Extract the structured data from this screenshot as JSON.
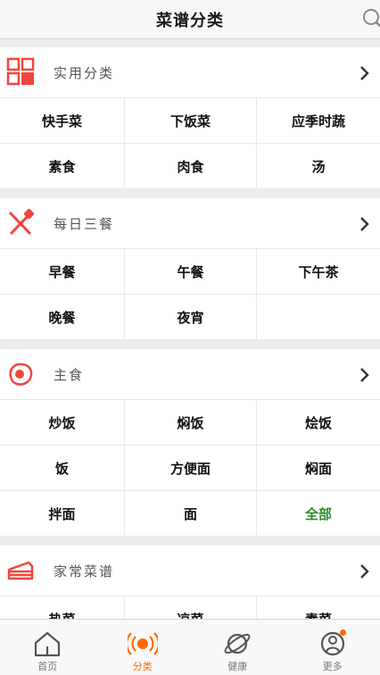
{
  "header": {
    "title": "菜谱分类"
  },
  "sections": [
    {
      "title": "实用分类",
      "icon": "grid-icon",
      "items": [
        "快手菜",
        "下饭菜",
        "应季时蔬",
        "素食",
        "肉食",
        "汤"
      ]
    },
    {
      "title": "每日三餐",
      "icon": "fork-knife-icon",
      "items": [
        "早餐",
        "午餐",
        "下午茶",
        "晚餐",
        "夜宵",
        ""
      ]
    },
    {
      "title": "主食",
      "icon": "fried-egg-icon",
      "items": [
        "炒饭",
        "焖饭",
        "烩饭",
        "饭",
        "方便面",
        "焖面",
        "拌面",
        "面",
        "全部"
      ]
    },
    {
      "title": "家常菜谱",
      "icon": "cake-icon",
      "items": [
        "热菜",
        "凉菜",
        "素菜"
      ]
    }
  ],
  "tabs": [
    {
      "label": "首页",
      "icon": "home-icon",
      "active": false
    },
    {
      "label": "分类",
      "icon": "broadcast-icon",
      "active": true
    },
    {
      "label": "健康",
      "icon": "planet-icon",
      "active": false
    },
    {
      "label": "更多",
      "icon": "user-icon",
      "active": false,
      "badge": true
    }
  ],
  "colors": {
    "accent": "#ff6a00",
    "icon_red": "#f0463c",
    "highlight_green": "#2e8b2e"
  }
}
